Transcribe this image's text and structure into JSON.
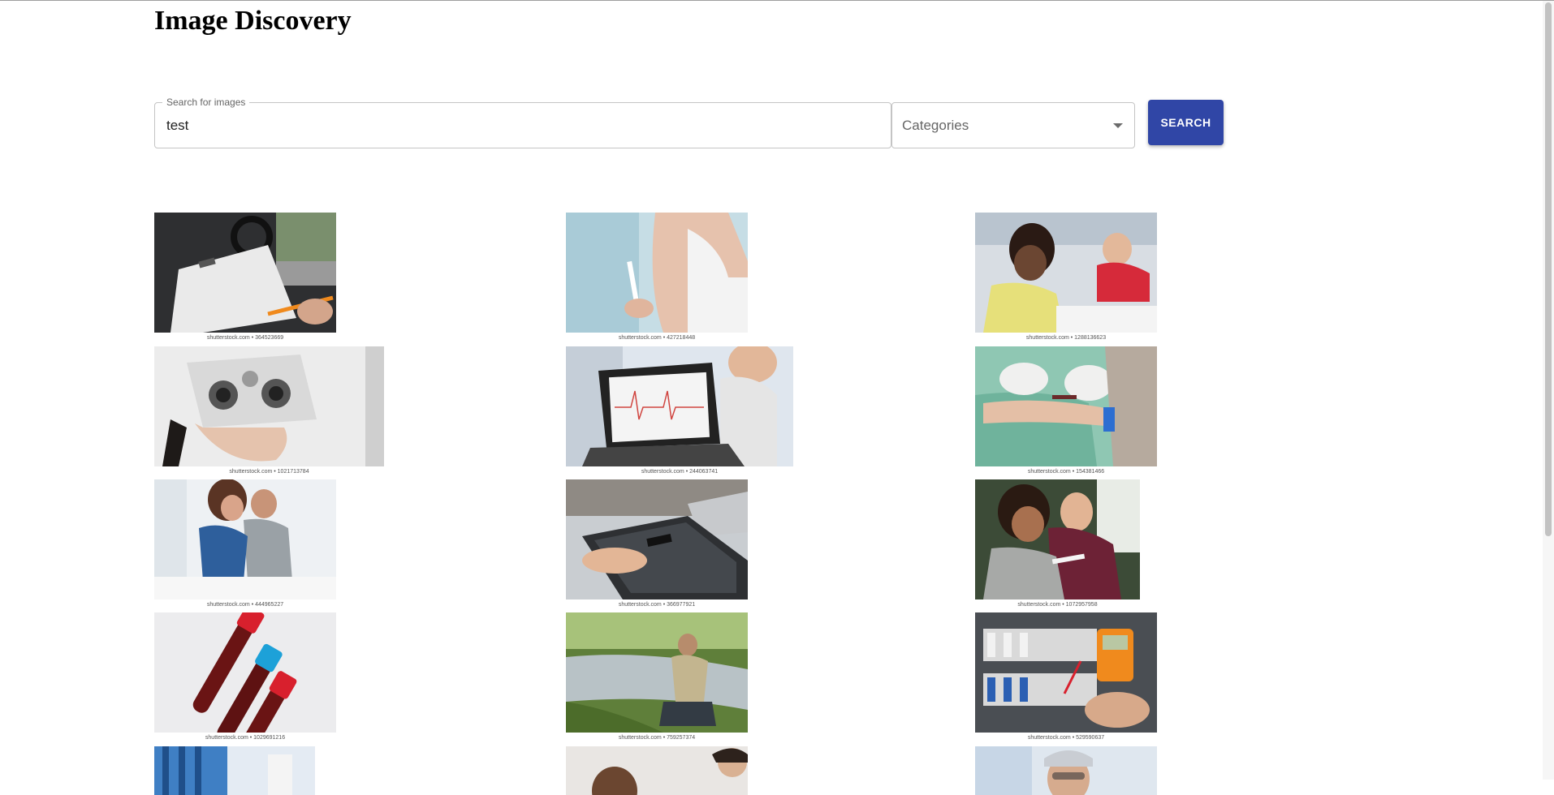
{
  "page": {
    "title": "Image Discovery"
  },
  "search": {
    "label": "Search for images",
    "value": "test",
    "button_label": "SEARCH"
  },
  "category": {
    "placeholder": "Categories"
  },
  "results": [
    {
      "caption": "shutterstock.com • 364523669",
      "description": "driver-clipboard-checklist"
    },
    {
      "caption": "shutterstock.com • 427218448",
      "description": "woman-holding-test"
    },
    {
      "caption": "shutterstock.com • 1288136623",
      "description": "children-writing-classroom"
    },
    {
      "caption": "shutterstock.com • 1021713784",
      "description": "eye-exam-phoropter"
    },
    {
      "caption": "shutterstock.com • 244063741",
      "description": "ecg-laptop-stress-test"
    },
    {
      "caption": "shutterstock.com • 154381466",
      "description": "blood-draw-nurse"
    },
    {
      "caption": "shutterstock.com • 444965227",
      "description": "couple-pregnancy-test"
    },
    {
      "caption": "shutterstock.com • 366977921",
      "description": "tablet-data-desk"
    },
    {
      "caption": "shutterstock.com • 1072957958",
      "description": "couple-pregnancy-test-happy"
    },
    {
      "caption": "shutterstock.com • 1029691216",
      "description": "blood-sample-tubes"
    },
    {
      "caption": "shutterstock.com • 759257374",
      "description": "water-sampling-river"
    },
    {
      "caption": "shutterstock.com • 529590637",
      "description": "electrician-multimeter"
    },
    {
      "caption": "",
      "description": "lab-test-tubes-blue"
    },
    {
      "caption": "",
      "description": "doctor-patient"
    },
    {
      "caption": "",
      "description": "lab-technician"
    }
  ],
  "colors": {
    "accent": "#3046a6",
    "border": "#c4c4c4"
  }
}
